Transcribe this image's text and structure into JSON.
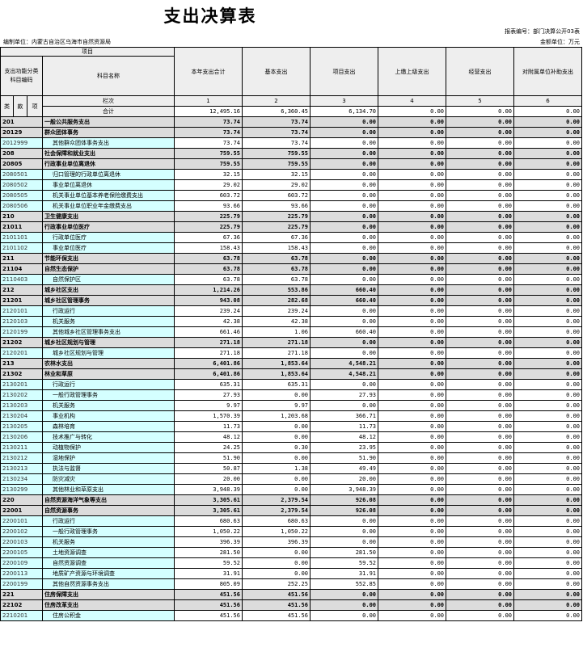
{
  "title": "支出决算表",
  "report_no": "报表编号：部门决算公开03表",
  "unit_left": "编制单位：内蒙古自治区乌海市自然资源局",
  "unit_right": "金额单位：万元",
  "headers": {
    "xiangmu": "项目",
    "func_code": "支出功能分类科目编码",
    "subject_name": "科目名称",
    "cols": [
      "本年支出合计",
      "基本支出",
      "项目支出",
      "上缴上级支出",
      "经营支出",
      "对附属单位补助支出"
    ],
    "lei": "类",
    "kuan": "款",
    "xiang": "项",
    "lanci": "栏次",
    "col_nums": [
      "1",
      "2",
      "3",
      "4",
      "5",
      "6"
    ],
    "total_label": "合计"
  },
  "total": [
    "12,495.16",
    "6,360.45",
    "6,134.70",
    "0.00",
    "0.00",
    "0.00"
  ],
  "rows": [
    {
      "code": "201",
      "name": "一般公共服务支出",
      "v": [
        "73.74",
        "73.74",
        "0.00",
        "0.00",
        "0.00",
        "0.00"
      ],
      "bold": true
    },
    {
      "code": "20129",
      "name": "群众团体事务",
      "v": [
        "73.74",
        "73.74",
        "0.00",
        "0.00",
        "0.00",
        "0.00"
      ],
      "bold": true
    },
    {
      "code": "2012999",
      "name": "其他群众团体事务支出",
      "v": [
        "73.74",
        "73.74",
        "0.00",
        "0.00",
        "0.00",
        "0.00"
      ],
      "bold": false
    },
    {
      "code": "208",
      "name": "社会保障和就业支出",
      "v": [
        "759.55",
        "759.55",
        "0.00",
        "0.00",
        "0.00",
        "0.00"
      ],
      "bold": true
    },
    {
      "code": "20805",
      "name": "行政事业单位离退休",
      "v": [
        "759.55",
        "759.55",
        "0.00",
        "0.00",
        "0.00",
        "0.00"
      ],
      "bold": true
    },
    {
      "code": "2080501",
      "name": "归口管理的行政单位离退休",
      "v": [
        "32.15",
        "32.15",
        "0.00",
        "0.00",
        "0.00",
        "0.00"
      ],
      "bold": false
    },
    {
      "code": "2080502",
      "name": "事业单位离退休",
      "v": [
        "29.02",
        "29.02",
        "0.00",
        "0.00",
        "0.00",
        "0.00"
      ],
      "bold": false
    },
    {
      "code": "2080505",
      "name": "机关事业单位基本养老保险缴费支出",
      "v": [
        "603.72",
        "603.72",
        "0.00",
        "0.00",
        "0.00",
        "0.00"
      ],
      "bold": false
    },
    {
      "code": "2080506",
      "name": "机关事业单位职业年金缴费支出",
      "v": [
        "93.66",
        "93.66",
        "0.00",
        "0.00",
        "0.00",
        "0.00"
      ],
      "bold": false
    },
    {
      "code": "210",
      "name": "卫生健康支出",
      "v": [
        "225.79",
        "225.79",
        "0.00",
        "0.00",
        "0.00",
        "0.00"
      ],
      "bold": true
    },
    {
      "code": "21011",
      "name": "行政事业单位医疗",
      "v": [
        "225.79",
        "225.79",
        "0.00",
        "0.00",
        "0.00",
        "0.00"
      ],
      "bold": true
    },
    {
      "code": "2101101",
      "name": "行政单位医疗",
      "v": [
        "67.36",
        "67.36",
        "0.00",
        "0.00",
        "0.00",
        "0.00"
      ],
      "bold": false
    },
    {
      "code": "2101102",
      "name": "事业单位医疗",
      "v": [
        "158.43",
        "158.43",
        "0.00",
        "0.00",
        "0.00",
        "0.00"
      ],
      "bold": false
    },
    {
      "code": "211",
      "name": "节能环保支出",
      "v": [
        "63.78",
        "63.78",
        "0.00",
        "0.00",
        "0.00",
        "0.00"
      ],
      "bold": true
    },
    {
      "code": "21104",
      "name": "自然生态保护",
      "v": [
        "63.78",
        "63.78",
        "0.00",
        "0.00",
        "0.00",
        "0.00"
      ],
      "bold": true
    },
    {
      "code": "2110403",
      "name": "自然保护区",
      "v": [
        "63.78",
        "63.78",
        "0.00",
        "0.00",
        "0.00",
        "0.00"
      ],
      "bold": false
    },
    {
      "code": "212",
      "name": "城乡社区支出",
      "v": [
        "1,214.26",
        "553.86",
        "660.40",
        "0.00",
        "0.00",
        "0.00"
      ],
      "bold": true
    },
    {
      "code": "21201",
      "name": "城乡社区管理事务",
      "v": [
        "943.08",
        "282.68",
        "660.40",
        "0.00",
        "0.00",
        "0.00"
      ],
      "bold": true
    },
    {
      "code": "2120101",
      "name": "行政运行",
      "v": [
        "239.24",
        "239.24",
        "0.00",
        "0.00",
        "0.00",
        "0.00"
      ],
      "bold": false
    },
    {
      "code": "2120103",
      "name": "机关服务",
      "v": [
        "42.38",
        "42.38",
        "0.00",
        "0.00",
        "0.00",
        "0.00"
      ],
      "bold": false
    },
    {
      "code": "2120199",
      "name": "其他城乡社区管理事务支出",
      "v": [
        "661.46",
        "1.06",
        "660.40",
        "0.00",
        "0.00",
        "0.00"
      ],
      "bold": false
    },
    {
      "code": "21202",
      "name": "城乡社区规划与管理",
      "v": [
        "271.18",
        "271.18",
        "0.00",
        "0.00",
        "0.00",
        "0.00"
      ],
      "bold": true
    },
    {
      "code": "2120201",
      "name": "城乡社区规划与管理",
      "v": [
        "271.18",
        "271.18",
        "0.00",
        "0.00",
        "0.00",
        "0.00"
      ],
      "bold": false
    },
    {
      "code": "213",
      "name": "农林水支出",
      "v": [
        "6,401.86",
        "1,853.64",
        "4,548.21",
        "0.00",
        "0.00",
        "0.00"
      ],
      "bold": true
    },
    {
      "code": "21302",
      "name": "林业和草原",
      "v": [
        "6,401.86",
        "1,853.64",
        "4,548.21",
        "0.00",
        "0.00",
        "0.00"
      ],
      "bold": true
    },
    {
      "code": "2130201",
      "name": "行政运行",
      "v": [
        "635.31",
        "635.31",
        "0.00",
        "0.00",
        "0.00",
        "0.00"
      ],
      "bold": false
    },
    {
      "code": "2130202",
      "name": "一般行政管理事务",
      "v": [
        "27.93",
        "0.00",
        "27.93",
        "0.00",
        "0.00",
        "0.00"
      ],
      "bold": false
    },
    {
      "code": "2130203",
      "name": "机关服务",
      "v": [
        "9.97",
        "9.97",
        "0.00",
        "0.00",
        "0.00",
        "0.00"
      ],
      "bold": false
    },
    {
      "code": "2130204",
      "name": "事业机构",
      "v": [
        "1,570.39",
        "1,203.68",
        "366.71",
        "0.00",
        "0.00",
        "0.00"
      ],
      "bold": false
    },
    {
      "code": "2130205",
      "name": "森林培育",
      "v": [
        "11.73",
        "0.00",
        "11.73",
        "0.00",
        "0.00",
        "0.00"
      ],
      "bold": false
    },
    {
      "code": "2130206",
      "name": "技术推广与转化",
      "v": [
        "48.12",
        "0.00",
        "48.12",
        "0.00",
        "0.00",
        "0.00"
      ],
      "bold": false
    },
    {
      "code": "2130211",
      "name": "动植物保护",
      "v": [
        "24.25",
        "0.30",
        "23.95",
        "0.00",
        "0.00",
        "0.00"
      ],
      "bold": false
    },
    {
      "code": "2130212",
      "name": "湿地保护",
      "v": [
        "51.90",
        "0.00",
        "51.90",
        "0.00",
        "0.00",
        "0.00"
      ],
      "bold": false
    },
    {
      "code": "2130213",
      "name": "执法与监督",
      "v": [
        "50.87",
        "1.38",
        "49.49",
        "0.00",
        "0.00",
        "0.00"
      ],
      "bold": false
    },
    {
      "code": "2130234",
      "name": "防灾减灾",
      "v": [
        "20.00",
        "0.00",
        "20.00",
        "0.00",
        "0.00",
        "0.00"
      ],
      "bold": false
    },
    {
      "code": "2130299",
      "name": "其他林业和草原支出",
      "v": [
        "3,948.39",
        "0.00",
        "3,948.39",
        "0.00",
        "0.00",
        "0.00"
      ],
      "bold": false
    },
    {
      "code": "220",
      "name": "自然资源海洋气象等支出",
      "v": [
        "3,305.61",
        "2,379.54",
        "926.08",
        "0.00",
        "0.00",
        "0.00"
      ],
      "bold": true
    },
    {
      "code": "22001",
      "name": "自然资源事务",
      "v": [
        "3,305.61",
        "2,379.54",
        "926.08",
        "0.00",
        "0.00",
        "0.00"
      ],
      "bold": true
    },
    {
      "code": "2200101",
      "name": "行政运行",
      "v": [
        "680.63",
        "680.63",
        "0.00",
        "0.00",
        "0.00",
        "0.00"
      ],
      "bold": false
    },
    {
      "code": "2200102",
      "name": "一般行政管理事务",
      "v": [
        "1,050.22",
        "1,050.22",
        "0.00",
        "0.00",
        "0.00",
        "0.00"
      ],
      "bold": false
    },
    {
      "code": "2200103",
      "name": "机关服务",
      "v": [
        "396.39",
        "396.39",
        "0.00",
        "0.00",
        "0.00",
        "0.00"
      ],
      "bold": false
    },
    {
      "code": "2200105",
      "name": "土地资源调查",
      "v": [
        "281.50",
        "0.00",
        "281.50",
        "0.00",
        "0.00",
        "0.00"
      ],
      "bold": false
    },
    {
      "code": "2200109",
      "name": "自然资源调查",
      "v": [
        "59.52",
        "0.00",
        "59.52",
        "0.00",
        "0.00",
        "0.00"
      ],
      "bold": false
    },
    {
      "code": "2200113",
      "name": "地质矿产资源与环境调查",
      "v": [
        "31.91",
        "0.00",
        "31.91",
        "0.00",
        "0.00",
        "0.00"
      ],
      "bold": false
    },
    {
      "code": "2200199",
      "name": "其他自然资源事务支出",
      "v": [
        "805.09",
        "252.25",
        "552.85",
        "0.00",
        "0.00",
        "0.00"
      ],
      "bold": false
    },
    {
      "code": "221",
      "name": "住房保障支出",
      "v": [
        "451.56",
        "451.56",
        "0.00",
        "0.00",
        "0.00",
        "0.00"
      ],
      "bold": true
    },
    {
      "code": "22102",
      "name": "住房改革支出",
      "v": [
        "451.56",
        "451.56",
        "0.00",
        "0.00",
        "0.00",
        "0.00"
      ],
      "bold": true
    },
    {
      "code": "2210201",
      "name": "住房公积金",
      "v": [
        "451.56",
        "451.56",
        "0.00",
        "0.00",
        "0.00",
        "0.00"
      ],
      "bold": false
    }
  ]
}
